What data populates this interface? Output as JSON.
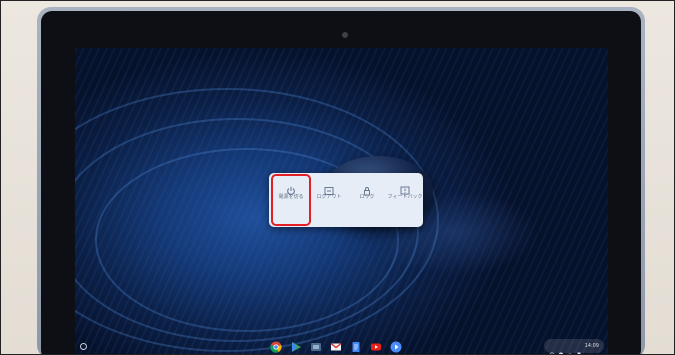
{
  "power_menu": {
    "items": [
      {
        "label": "電源を切る",
        "icon": "power-icon"
      },
      {
        "label": "ログアウト",
        "icon": "logout-icon"
      },
      {
        "label": "ロック",
        "icon": "lock-icon"
      },
      {
        "label": "フィードバック",
        "icon": "feedback-icon"
      }
    ]
  },
  "shelf": {
    "apps": [
      {
        "name": "Chrome",
        "icon": "chrome-icon",
        "color": "#f4b400"
      },
      {
        "name": "Play Store",
        "icon": "play-store-icon",
        "color": "#34a853"
      },
      {
        "name": "Files",
        "icon": "files-icon",
        "color": "#4d6b8a"
      },
      {
        "name": "Gmail",
        "icon": "gmail-icon",
        "color": "#d93025"
      },
      {
        "name": "Docs",
        "icon": "docs-icon",
        "color": "#4285f4"
      },
      {
        "name": "YouTube",
        "icon": "youtube-icon",
        "color": "#e62117"
      },
      {
        "name": "Play Movies",
        "icon": "play-movies-icon",
        "color": "#4a8cf7"
      }
    ],
    "status": {
      "time": "14:09"
    }
  },
  "colors": {
    "highlight": "#e21f25",
    "menu_bg": "#e7edf6"
  }
}
